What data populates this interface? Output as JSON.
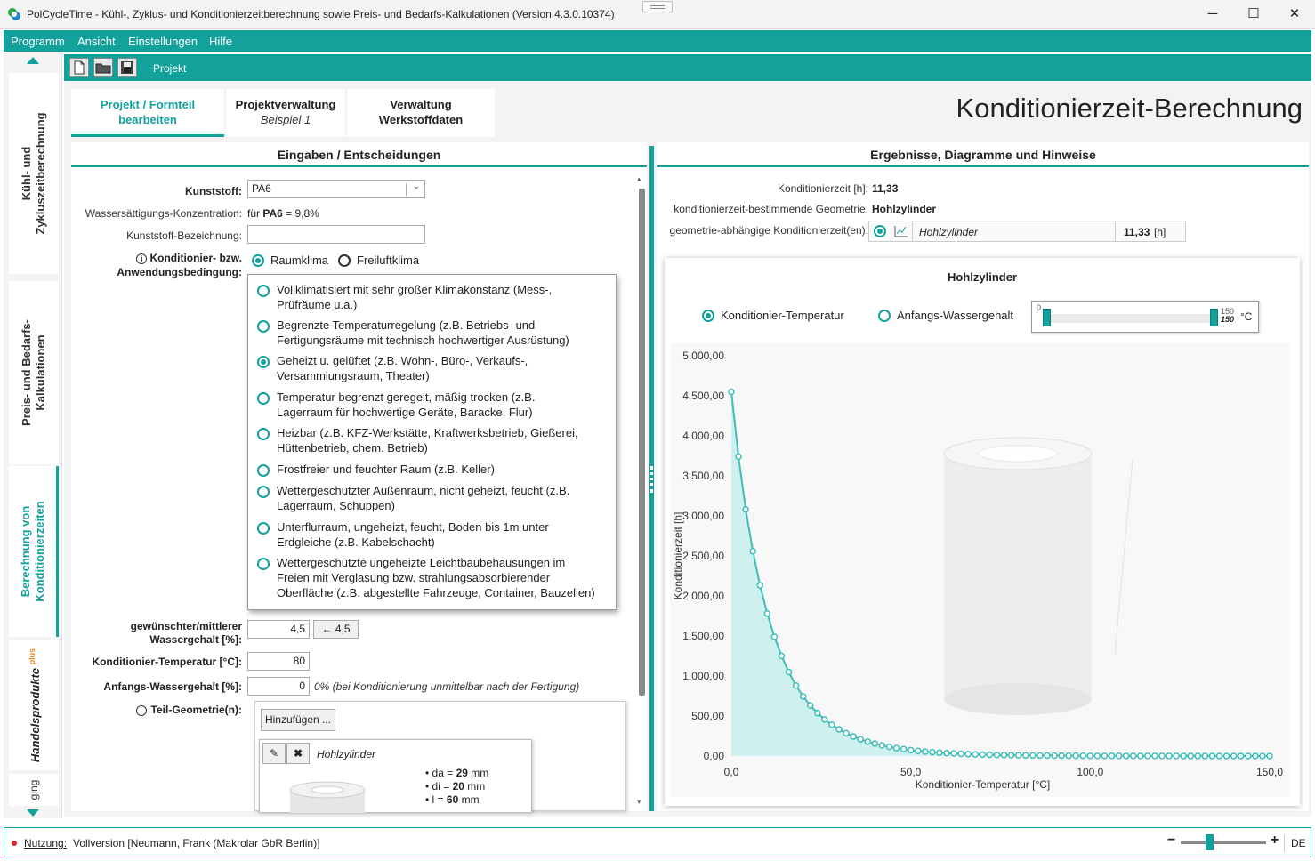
{
  "window": {
    "title": "PolCycleTime - Kühl-, Zyklus- und Konditionierzeitberechnung sowie Preis- und Bedarfs-Kalkulationen (Version 4.3.0.10374)",
    "minimize": "─",
    "maximize": "☐",
    "close": "✕"
  },
  "menu": [
    "Programm",
    "Ansicht",
    "Einstellungen",
    "Hilfe"
  ],
  "leftnav": {
    "tabs": [
      {
        "label_line1": "Kühl- und",
        "label_line2": "Zykluszeitberechnung"
      },
      {
        "label_line1": "Preis- und Bedarfs-",
        "label_line2": "Kalkulationen"
      },
      {
        "label_line1": "Berechnung von",
        "label_line2": "Konditionierzeiten"
      },
      {
        "label_line1": "Handelsprodukte",
        "badge": "plus"
      },
      {
        "label_line1": "ging"
      }
    ]
  },
  "toolbar": {
    "label": "Projekt",
    "icons": [
      "new-file-icon",
      "open-folder-icon",
      "save-icon"
    ]
  },
  "page_tabs": [
    {
      "line1": "Projekt / Formteil",
      "line2": "bearbeiten"
    },
    {
      "line1": "Projektverwaltung",
      "line2": "Beispiel 1"
    },
    {
      "line1": "Verwaltung",
      "line2": "Werkstoffdaten"
    }
  ],
  "page_title": "Konditionierzeit-Berechnung",
  "inputs": {
    "header": "Eingaben / Entscheidungen",
    "kunststoff_label": "Kunststoff:",
    "kunststoff_value": "PA6",
    "wasser_label": "Wassersättigungs-Konzentration:",
    "wasser_prefix": "für",
    "wasser_material": "PA6",
    "wasser_value": "= 9,8%",
    "bezeichnung_label": "Kunststoff-Bezeichnung:",
    "bezeichnung_value": "",
    "kond_label_line1": "Konditionier- bzw.",
    "kond_label_line2": "Anwendungsbedingung:",
    "raumklima": "Raumklima",
    "freiluftklima": "Freiluftklima",
    "options": [
      {
        "line1": "Vollklimatisiert mit sehr großer Klimakonstanz (Mess-,",
        "line2": "Prüfräume u.a.)",
        "line3": ""
      },
      {
        "line1": "Begrenzte Temperaturregelung (z.B. Betriebs- und",
        "line2": "Fertigungsräume mit technisch hochwertiger Ausrüstung)",
        "line3": ""
      },
      {
        "line1": "Geheizt u. gelüftet (z.B. Wohn-, Büro-, Verkaufs-,",
        "line2": "Versammlungsraum, Theater)",
        "line3": ""
      },
      {
        "line1": "Temperatur begrenzt geregelt, mäßig trocken (z.B.",
        "line2": "Lagerraum für hochwertige Geräte, Baracke, Flur)",
        "line3": ""
      },
      {
        "line1": "Heizbar (z.B. KFZ-Werkstätte, Kraftwerksbetrieb, Gießerei,",
        "line2": "Hüttenbetrieb, chem. Betrieb)",
        "line3": ""
      },
      {
        "line1": "Frostfreier und feuchter Raum (z.B. Keller)",
        "line2": "",
        "line3": ""
      },
      {
        "line1": "Wettergeschützter Außenraum, nicht geheizt, feucht (z.B.",
        "line2": "Lagerraum, Schuppen)",
        "line3": ""
      },
      {
        "line1": "Unterflurraum, ungeheizt, feucht, Boden bis 1m unter",
        "line2": "Erdgleiche (z.B. Kabelschacht)",
        "line3": ""
      },
      {
        "line1": "Wettergeschützte ungeheizte Leichtbaubehausungen im",
        "line2": "Freien mit Verglasung bzw. strahlungsabsorbierender",
        "line3": "Oberfläche (z.B. abgestellte Fahrzeuge, Container, Bauzellen)"
      }
    ],
    "selected_option": 2,
    "wassergehalt_label_line1": "gewünschter/mittlerer",
    "wassergehalt_label_line2": "Wassergehalt [%]:",
    "wassergehalt_value": "4,5",
    "wassergehalt_button": "← 4,5",
    "temp_label": "Konditionier-Temperatur [°C]:",
    "temp_value": "80",
    "anfang_label": "Anfangs-Wassergehalt [%]:",
    "anfang_value": "0",
    "anfang_hint": "0% (bei Konditionierung unmittelbar nach der Fertigung)",
    "teil_label": "Teil-Geometrie(n):",
    "add_button": "Hinzufügen ...",
    "geometry_name": "Hohlzylinder",
    "dims": [
      {
        "name": "da",
        "value": "29",
        "unit": "mm"
      },
      {
        "name": "di",
        "value": "20",
        "unit": "mm"
      },
      {
        "name": "l",
        "value": "60",
        "unit": "mm"
      }
    ]
  },
  "results": {
    "header": "Ergebnisse, Diagramme und Hinweise",
    "kondzeit_label": "Konditionierzeit [h]:",
    "kondzeit_value": "11,33",
    "geometry_label": "konditionierzeit-bestimmende Geometrie:",
    "geometry_value": "Hohlzylinder",
    "geo_times_label": "geometrie-abhängige Konditionierzeit(en):",
    "geo_row_name": "Hohlzylinder",
    "geo_row_value": "11,33",
    "geo_row_unit": "[h]"
  },
  "chart_panel": {
    "title": "Hohlzylinder",
    "radio_temp": "Konditionier-Temperatur",
    "radio_wasser": "Anfangs-Wassergehalt",
    "slider_min": "0",
    "slider_max": "150",
    "slider_max_value": "150",
    "slider_unit": "°C"
  },
  "chart_data": {
    "type": "area",
    "xlabel": "Konditionier-Temperatur [°C]",
    "ylabel": "Konditionierzeit [h]",
    "xlim": [
      0,
      150
    ],
    "ylim": [
      0,
      5000
    ],
    "x_ticks": [
      "0,0",
      "50,0",
      "100,0",
      "150,0"
    ],
    "y_ticks": [
      "0,00",
      "500,00",
      "1.000,00",
      "1.500,00",
      "2.000,00",
      "2.500,00",
      "3.000,00",
      "3.500,00",
      "4.000,00",
      "4.500,00",
      "5.000,00"
    ],
    "grid": false,
    "series_color": "#3fbdb8",
    "fill_color": "#c9eeed",
    "x": [
      0,
      2,
      4,
      6,
      8,
      10,
      12,
      14,
      16,
      18,
      20,
      22,
      24,
      26,
      28,
      30,
      32,
      34,
      36,
      38,
      40,
      42,
      44,
      46,
      48,
      50,
      52,
      54,
      56,
      58,
      60,
      62,
      64,
      66,
      68,
      70,
      72,
      74,
      76,
      78,
      80,
      82,
      84,
      86,
      88,
      90,
      92,
      94,
      96,
      98,
      100,
      102,
      104,
      106,
      108,
      110,
      112,
      114,
      116,
      118,
      120,
      122,
      124,
      126,
      128,
      130,
      132,
      134,
      136,
      138,
      140,
      142,
      144,
      146,
      148,
      150
    ],
    "y": [
      4550,
      3740,
      3080,
      2560,
      2130,
      1780,
      1490,
      1250,
      1050,
      880,
      745,
      632,
      537,
      457,
      390,
      333,
      285,
      244,
      209,
      180,
      155,
      133,
      115,
      99,
      86,
      74,
      64,
      56,
      48,
      42,
      36,
      32,
      28,
      24,
      21,
      18,
      16,
      14,
      12.5,
      11.33,
      10,
      9,
      8,
      7,
      6.3,
      5.6,
      5,
      4.5,
      4,
      3.6,
      3.2,
      2.9,
      2.6,
      2.3,
      2.1,
      1.9,
      1.7,
      1.5,
      1.4,
      1.3,
      1.2,
      1.1,
      1,
      0.9,
      0.8,
      0.75,
      0.7,
      0.65,
      0.6,
      0.55,
      0.5,
      0.45,
      0.42,
      0.4,
      0.37,
      0.35
    ]
  },
  "statusbar": {
    "label": "Nutzung:",
    "value": "Vollversion [Neumann, Frank (Makrolar GbR Berlin)]",
    "minus": "−",
    "plus": "+",
    "language": "DE"
  },
  "colors": {
    "accent": "#13a19b",
    "status_dot": "#d9232d"
  }
}
